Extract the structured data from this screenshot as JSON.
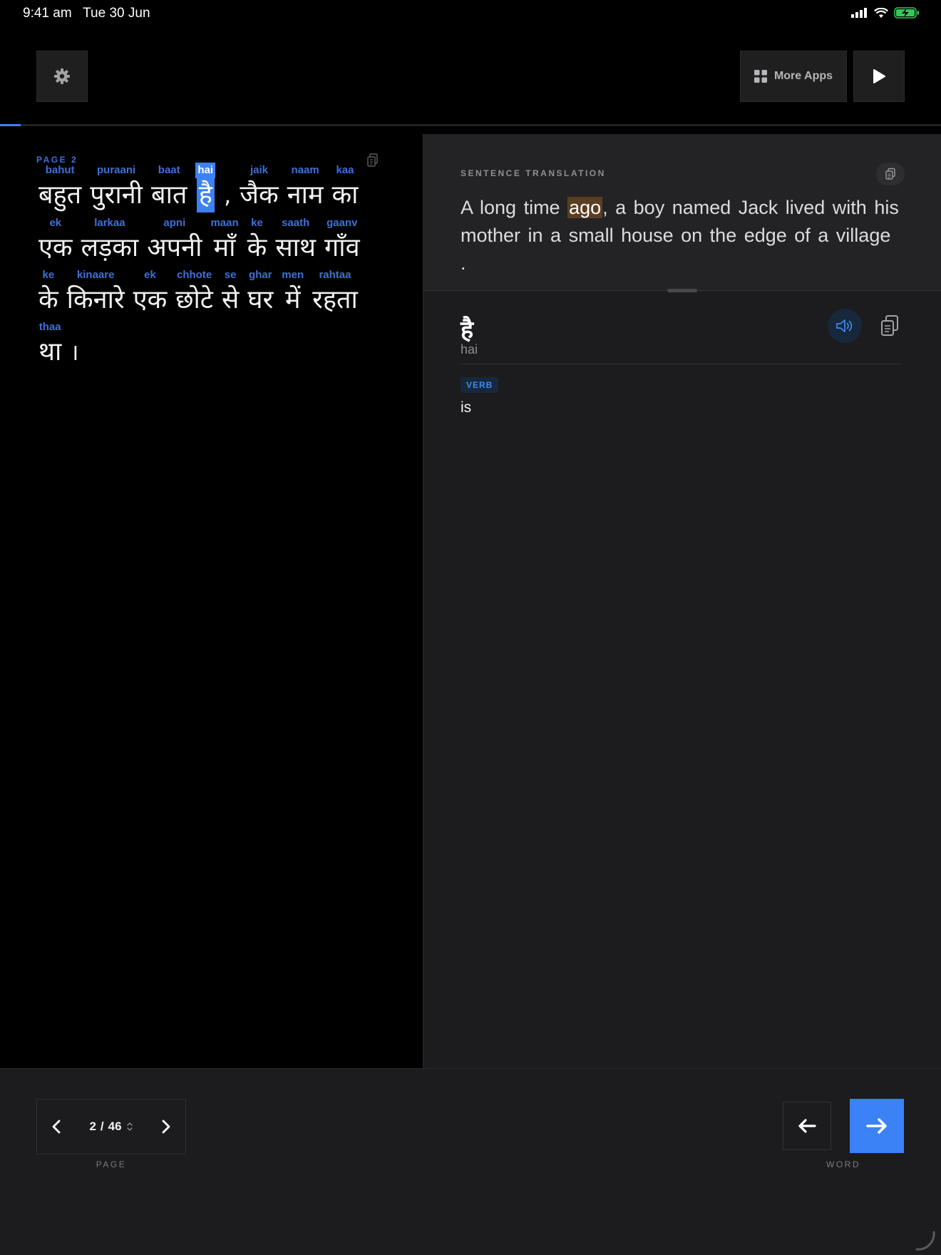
{
  "status": {
    "time": "9:41 am",
    "date": "Tue 30 Jun"
  },
  "toolbar": {
    "more_apps_label": "More Apps"
  },
  "progress": {
    "fraction": 0.022
  },
  "reader": {
    "page_label": "PAGE  2",
    "lines": [
      [
        {
          "t": "bahut",
          "h": "बहुत"
        },
        {
          "t": "puraani",
          "h": "पुरानी"
        },
        {
          "t": "baat",
          "h": "बात"
        },
        {
          "t": "hai",
          "h": "है",
          "active": true
        },
        {
          "p": ","
        },
        {
          "t": "jaik",
          "h": "जैक"
        },
        {
          "t": "naam",
          "h": "नाम"
        },
        {
          "t": "kaa",
          "h": "का"
        }
      ],
      [
        {
          "t": "ek",
          "h": "एक"
        },
        {
          "t": "larkaa",
          "h": "लड़का"
        },
        {
          "t": "apni",
          "h": "अपनी"
        },
        {
          "t": "maan",
          "h": "माँ"
        },
        {
          "t": "ke",
          "h": "के"
        },
        {
          "t": "saath",
          "h": "साथ"
        },
        {
          "t": "gaanv",
          "h": "गाँव"
        }
      ],
      [
        {
          "t": "ke",
          "h": "के"
        },
        {
          "t": "kinaare",
          "h": "किनारे"
        },
        {
          "t": "ek",
          "h": "एक"
        },
        {
          "t": "chhote",
          "h": "छोटे"
        },
        {
          "t": "se",
          "h": "से"
        },
        {
          "t": "ghar",
          "h": "घर"
        },
        {
          "t": "men",
          "h": "में"
        },
        {
          "t": "rahtaa",
          "h": "रहता"
        }
      ],
      [
        {
          "t": "thaa",
          "h": "था"
        },
        {
          "p": "।"
        }
      ]
    ]
  },
  "translation": {
    "heading": "SENTENCE TRANSLATION",
    "before": "A long time ",
    "highlight": "ago",
    "after": ", a boy named Jack lived with his mother in a small house on the edge of a village ."
  },
  "word_detail": {
    "word": "है",
    "romanized": "hai",
    "part_of_speech": "VERB",
    "meaning": "is"
  },
  "pager": {
    "current": "2",
    "separator": "/",
    "total": "46",
    "label": "PAGE"
  },
  "word_nav": {
    "label": "WORD"
  },
  "colors": {
    "accent": "#3b82f6",
    "translit": "#3f70d6",
    "highlight": "#5a3e22"
  }
}
